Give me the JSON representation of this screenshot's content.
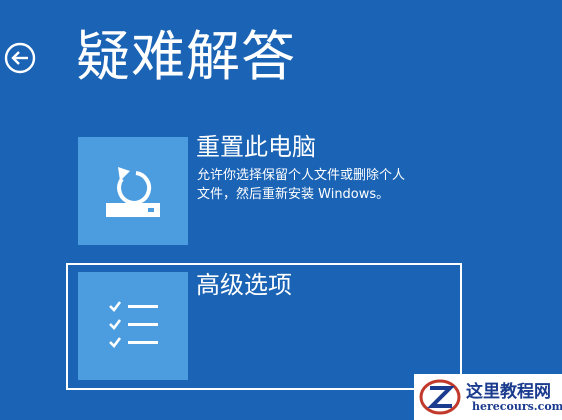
{
  "page": {
    "title": "疑难解答",
    "back_icon": "back-arrow-icon"
  },
  "colors": {
    "background": "#1a63b5",
    "tile": "#4c9de0",
    "text": "#ffffff"
  },
  "options": [
    {
      "title": "重置此电脑",
      "description_line1": "允许你选择保留个人文件或删除个人",
      "description_line2": "文件，然后重新安装 Windows。",
      "icon": "reset-pc-icon"
    },
    {
      "title": "高级选项",
      "icon": "checklist-icon",
      "selected": true
    }
  ],
  "watermark": {
    "name": "这里教程网",
    "url": "herecours.com"
  }
}
